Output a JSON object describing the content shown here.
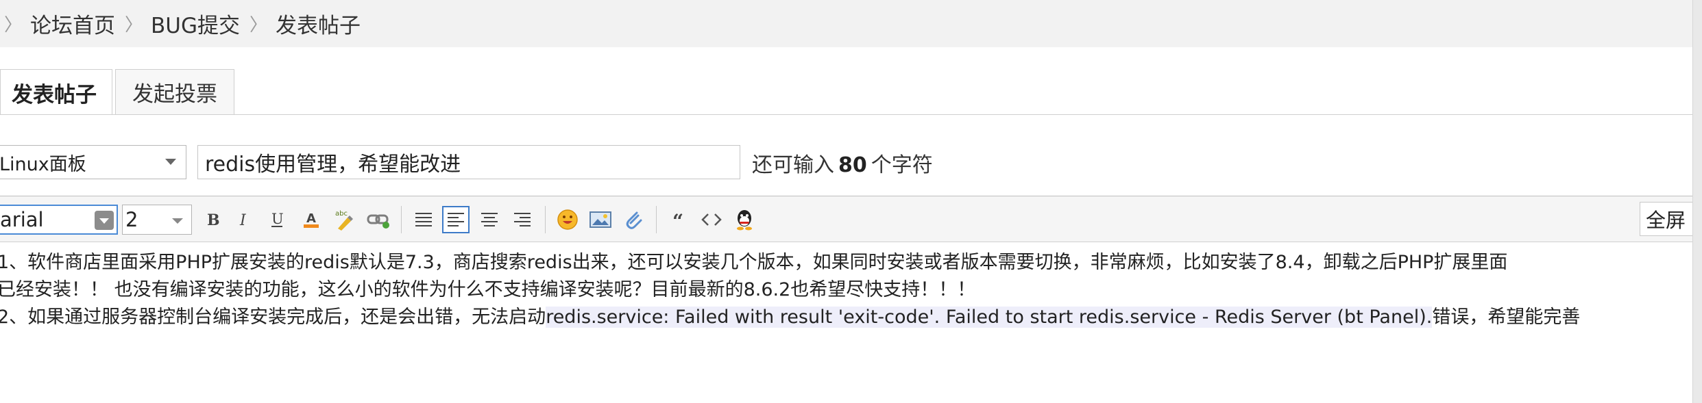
{
  "breadcrumb": {
    "items": [
      "论坛首页",
      "BUG提交",
      "发表帖子"
    ],
    "separator": "〉"
  },
  "tabs": [
    {
      "label": "发表帖子",
      "active": true
    },
    {
      "label": "发起投票",
      "active": false
    }
  ],
  "post_form": {
    "forum_select_value": "Linux面板",
    "title_value": "redis使用管理，希望能改进",
    "char_hint_prefix": "还可输入",
    "char_hint_count": "80",
    "char_hint_suffix": "个字符"
  },
  "toolbar": {
    "font_value": "arial",
    "size_value": "2",
    "fullscreen_label": "全屏",
    "buttons": [
      "bold-icon",
      "italic-icon",
      "underline-icon",
      "font-color-icon",
      "highlight-icon",
      "link-icon",
      "align-left-icon",
      "align-left-selected-icon",
      "align-center-icon",
      "align-right-icon",
      "emoji-icon",
      "image-icon",
      "attachment-icon",
      "quote-icon",
      "code-icon",
      "qq-icon"
    ]
  },
  "content": {
    "line1": "1、软件商店里面采用PHP扩展安装的redis默认是7.3，商店搜索redis出来，还可以安装几个版本，如果同时安装或者版本需要切换，非常麻烦，比如安装了8.4，卸载之后PHP扩展里面",
    "line2": "已经安装！！ 也没有编译安装的功能，这么小的软件为什么不支持编译安装呢？目前最新的8.6.2也希望尽快支持！！！",
    "line3_start": "2、如果通过服务器控制台编译安装完成后，还是会出错，无法启动",
    "line3_highlight": "redis.service: Failed with result 'exit-code'. Failed to start redis.service - Redis Server (bt Panel).",
    "line3_end": "错误，希望能完善"
  },
  "colors": {
    "accent": "#3d7bc8",
    "breadcrumb_bg": "#f2f2f2",
    "toolbar_bg": "#f5f5f5",
    "highlight_bg": "#eeeefa"
  }
}
